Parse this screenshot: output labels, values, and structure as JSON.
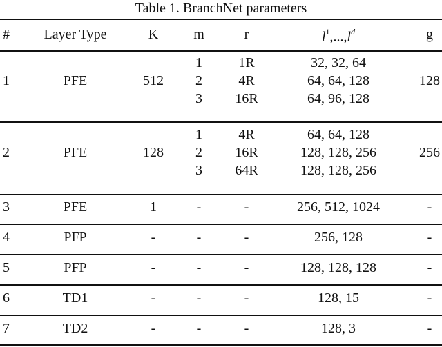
{
  "caption": "Table 1. BranchNet parameters",
  "header": {
    "num": "#",
    "layer_type": "Layer Type",
    "K": "K",
    "m": "m",
    "r": "r",
    "l_base": "l",
    "l_sup_first": "1",
    "l_sep": ",...,",
    "l_sup_last": "d",
    "g": "g"
  },
  "rows": [
    {
      "num": "1",
      "layer_type": "PFE",
      "K": "512",
      "g": "128",
      "sub": [
        {
          "m": "1",
          "r": "1R",
          "l": "32, 32, 64"
        },
        {
          "m": "2",
          "r": "4R",
          "l": "64, 64, 128"
        },
        {
          "m": "3",
          "r": "16R",
          "l": "64, 96, 128"
        }
      ]
    },
    {
      "num": "2",
      "layer_type": "PFE",
      "K": "128",
      "g": "256",
      "sub": [
        {
          "m": "1",
          "r": "4R",
          "l": "64, 64, 128"
        },
        {
          "m": "2",
          "r": "16R",
          "l": "128, 128, 256"
        },
        {
          "m": "3",
          "r": "64R",
          "l": "128, 128, 256"
        }
      ]
    },
    {
      "num": "3",
      "layer_type": "PFE",
      "K": "1",
      "m": "-",
      "r": "-",
      "l": "256, 512, 1024",
      "g": "-"
    },
    {
      "num": "4",
      "layer_type": "PFP",
      "K": "-",
      "m": "-",
      "r": "-",
      "l": "256, 128",
      "g": "-"
    },
    {
      "num": "5",
      "layer_type": "PFP",
      "K": "-",
      "m": "-",
      "r": "-",
      "l": "128, 128, 128",
      "g": "-"
    },
    {
      "num": "6",
      "layer_type": "TD1",
      "K": "-",
      "m": "-",
      "r": "-",
      "l": "128, 15",
      "g": "-"
    },
    {
      "num": "7",
      "layer_type": "TD2",
      "K": "-",
      "m": "-",
      "r": "-",
      "l": "128, 3",
      "g": "-"
    }
  ]
}
